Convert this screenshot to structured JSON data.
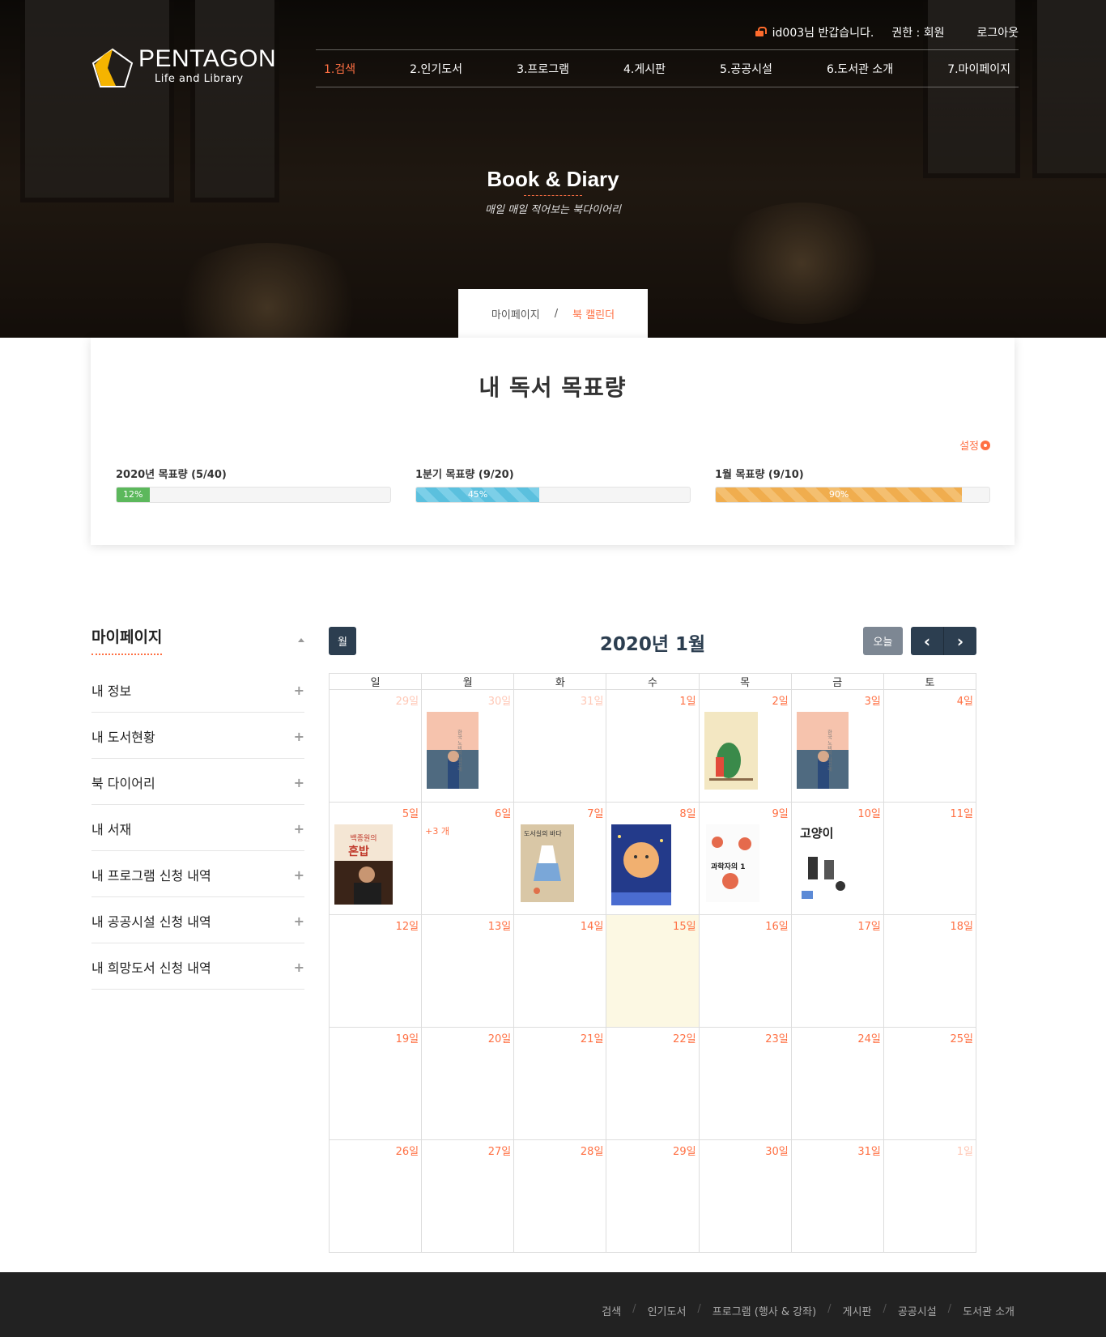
{
  "topbar": {
    "greeting": "id003님 반갑습니다.",
    "role": "권한 : 회원",
    "logout": "로그아웃"
  },
  "logo": {
    "name": "PENTAGON",
    "tagline": "Life and Library"
  },
  "nav": [
    "1.검색",
    "2.인기도서",
    "3.프로그램",
    "4.게시판",
    "5.공공시설",
    "6.도서관 소개",
    "7.마이페이지"
  ],
  "hero": {
    "title": "Book & Diary",
    "subtitle": "매일 매일 적어보는 북다이어리"
  },
  "breadcrumb": {
    "parent": "마이페이지",
    "sep": "/",
    "current": "북 캘린더"
  },
  "goals": {
    "title": "내 독서 목표량",
    "setting": "설정",
    "items": [
      {
        "label": "2020년 목표량 (5/40)",
        "percent_text": "12%",
        "fraction": 0.12,
        "color": "#5cb85c"
      },
      {
        "label": "1분기 목표량 (9/20)",
        "percent_text": "45%",
        "fraction": 0.45,
        "color": "#5bc0de"
      },
      {
        "label": "1월 목표량 (9/10)",
        "percent_text": "90%",
        "fraction": 0.9,
        "color": "#f0ad4e"
      }
    ]
  },
  "sidebar": {
    "title": "마이페이지",
    "items": [
      "내 정보",
      "내 도서현황",
      "북 다이어리",
      "내 서재",
      "내 프로그램 신청 내역",
      "내 공공시설 신청 내역",
      "내 희망도서 신청 내역"
    ]
  },
  "calendar": {
    "month_button": "월",
    "title": "2020년 1월",
    "today_button": "오늘",
    "weekdays": [
      "일",
      "월",
      "화",
      "수",
      "목",
      "금",
      "토"
    ],
    "weeks": [
      [
        "29일",
        "30일",
        "31일",
        "1일",
        "2일",
        "3일",
        "4일"
      ],
      [
        "5일",
        "6일",
        "7일",
        "8일",
        "9일",
        "10일",
        "11일"
      ],
      [
        "12일",
        "13일",
        "14일",
        "15일",
        "16일",
        "17일",
        "18일"
      ],
      [
        "19일",
        "20일",
        "21일",
        "22일",
        "23일",
        "24일",
        "25일"
      ],
      [
        "26일",
        "27일",
        "28일",
        "29일",
        "30일",
        "31일",
        "1일"
      ]
    ],
    "more_label": "+3 개",
    "book_text": {
      "cover_a": "한국 노비리 나그네",
      "baek": "백종원의",
      "honbap": "혼밥",
      "sea": "도서실의 바다",
      "cat": "고양이",
      "science": "과학자의 1"
    }
  },
  "footer": [
    "검색",
    "인기도서",
    "프로그램 (행사 & 강좌)",
    "게시판",
    "공공시설",
    "도서관 소개"
  ],
  "colors": {
    "accent": "#ff7043",
    "navy": "#2c3e50",
    "footer_bg": "#222222",
    "today_bg": "#fcf8e3"
  }
}
